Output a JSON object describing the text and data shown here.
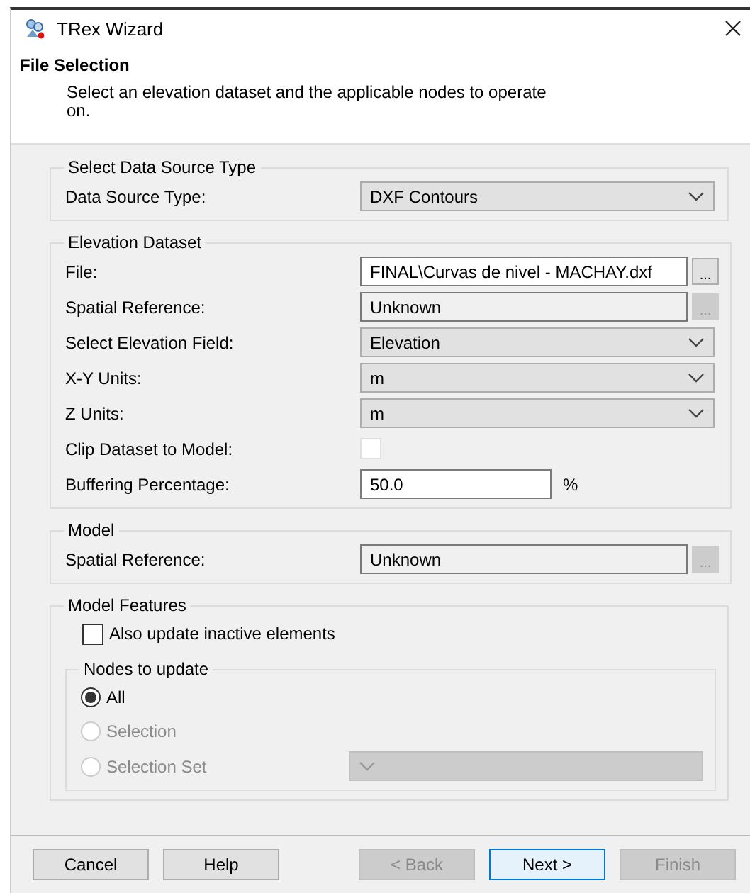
{
  "window": {
    "title": "TRex Wizard"
  },
  "header": {
    "title": "File Selection",
    "description": "Select an elevation dataset and the applicable nodes to operate on."
  },
  "groups": [
    {
      "title": "Select Data Source Type",
      "rows": [
        {
          "kind": "select",
          "label": "Data Source Type:",
          "value": "DXF Contours"
        }
      ]
    },
    {
      "title": "Elevation Dataset",
      "rows": [
        {
          "kind": "browse",
          "label": "File:",
          "value": "FINAL\\Curvas de nivel - MACHAY.dxf",
          "browse": "...",
          "disabled": false
        },
        {
          "kind": "browse",
          "label": "Spatial Reference:",
          "value": "Unknown",
          "browse": "...",
          "disabled": true
        },
        {
          "kind": "select",
          "label": "Select Elevation Field:",
          "value": "Elevation"
        },
        {
          "kind": "select",
          "label": "X-Y Units:",
          "value": "m"
        },
        {
          "kind": "select",
          "label": "Z Units:",
          "value": "m"
        },
        {
          "kind": "checkbox",
          "label": "Clip Dataset to Model:",
          "checked": false
        },
        {
          "kind": "number",
          "label": "Buffering Percentage:",
          "value": "50.0",
          "unit": "%"
        }
      ]
    },
    {
      "title": "Model",
      "rows": [
        {
          "kind": "browse",
          "label": "Spatial Reference:",
          "value": "Unknown",
          "browse": "...",
          "disabled": true
        }
      ]
    }
  ],
  "model_features": {
    "title": "Model Features",
    "also_update": {
      "label": "Also update inactive elements",
      "checked": false
    },
    "nodes": {
      "title": "Nodes to update",
      "options": [
        {
          "label": "All",
          "selected": true,
          "disabled": false
        },
        {
          "label": "Selection",
          "selected": false,
          "disabled": true
        },
        {
          "label": "Selection Set",
          "selected": false,
          "disabled": true,
          "dropdown": true
        }
      ]
    }
  },
  "buttons": [
    {
      "label": "Cancel",
      "disabled": false,
      "default": false
    },
    {
      "label": "Help",
      "disabled": false,
      "default": false
    },
    {
      "label": "< Back",
      "disabled": true,
      "default": false
    },
    {
      "label": "Next >",
      "disabled": false,
      "default": true
    },
    {
      "label": "Finish",
      "disabled": true,
      "default": false
    }
  ]
}
